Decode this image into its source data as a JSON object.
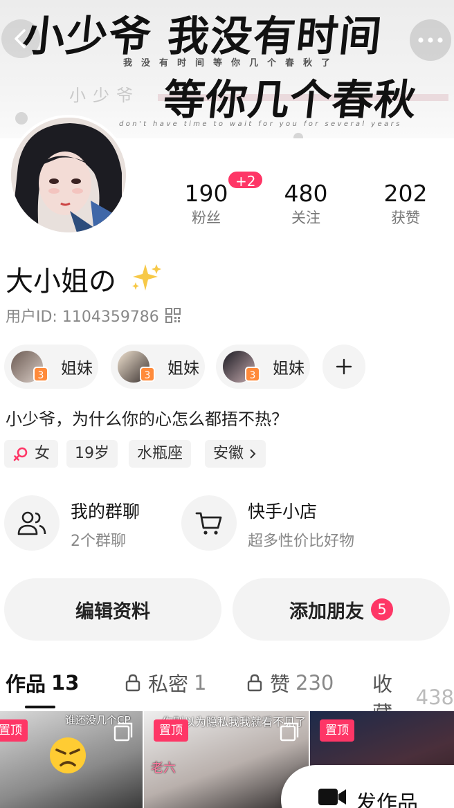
{
  "banner": {
    "line1": "小少爷 我没有时间",
    "small_line": "我没有时间等你几个春秋了",
    "watermark": "小少爷",
    "line2": "等你几个春秋了",
    "english": "don't have time to wait for you for several years"
  },
  "stats": {
    "fans_count": "190",
    "fans_label": "粉丝",
    "fans_delta": "+2",
    "following_count": "480",
    "following_label": "关注",
    "likes_count": "202",
    "likes_label": "获赞"
  },
  "profile": {
    "nickname": "大小姐の",
    "user_id": "用户ID: 1104359786",
    "bio": "小少爷，为什么你的心怎么都捂不热？"
  },
  "friends": [
    {
      "label": "姐妹",
      "level": "3"
    },
    {
      "label": "姐妹",
      "level": "3"
    },
    {
      "label": "姐妹",
      "level": "3"
    }
  ],
  "tags": {
    "gender": "女",
    "age": "19岁",
    "zodiac": "水瓶座",
    "location": "安徽"
  },
  "features": {
    "group_title": "我的群聊",
    "group_sub": "2个群聊",
    "shop_title": "快手小店",
    "shop_sub": "超多性价比好物"
  },
  "actions": {
    "edit_label": "编辑资料",
    "add_friend_label": "添加朋友",
    "add_friend_count": "5"
  },
  "tabs": [
    {
      "label": "作品",
      "count": "13"
    },
    {
      "label": "私密",
      "count": "1"
    },
    {
      "label": "赞",
      "count": "230"
    },
    {
      "label": "收藏",
      "count": "438"
    }
  ],
  "grid": {
    "pin_label": "置顶",
    "thumb1_caption": "谁还没几个CP",
    "thumb2_caption": "你别以为隐私我我就看不见了",
    "thumb2_name": "老六"
  },
  "post_button_label": "发作品",
  "colors": {
    "accent": "#fe3666",
    "level_badge": "#ff8a3a"
  }
}
